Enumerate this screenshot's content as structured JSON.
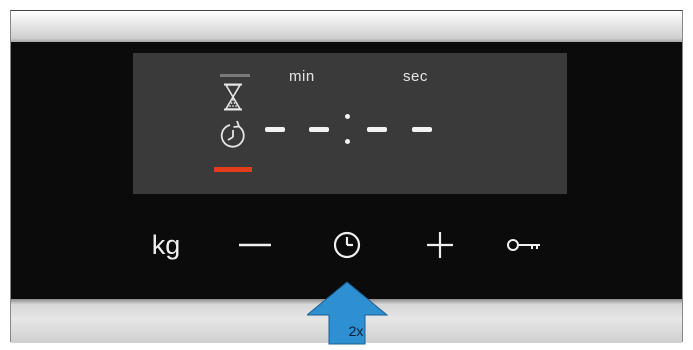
{
  "display": {
    "min_label": "min",
    "sec_label": "sec",
    "time_readout": "- - : - -",
    "icons": [
      "hourglass-icon",
      "timer-icon"
    ],
    "active_indicator_color": "#e23c1c",
    "inactive_indicator_color": "#7a7a7a"
  },
  "buttons": {
    "kg_label": "kg",
    "minus_icon": "minus-icon",
    "clock_icon": "clock-icon",
    "plus_icon": "plus-icon",
    "key_icon": "key-icon"
  },
  "callout": {
    "label": "2x",
    "color": "#2e8fd1"
  }
}
